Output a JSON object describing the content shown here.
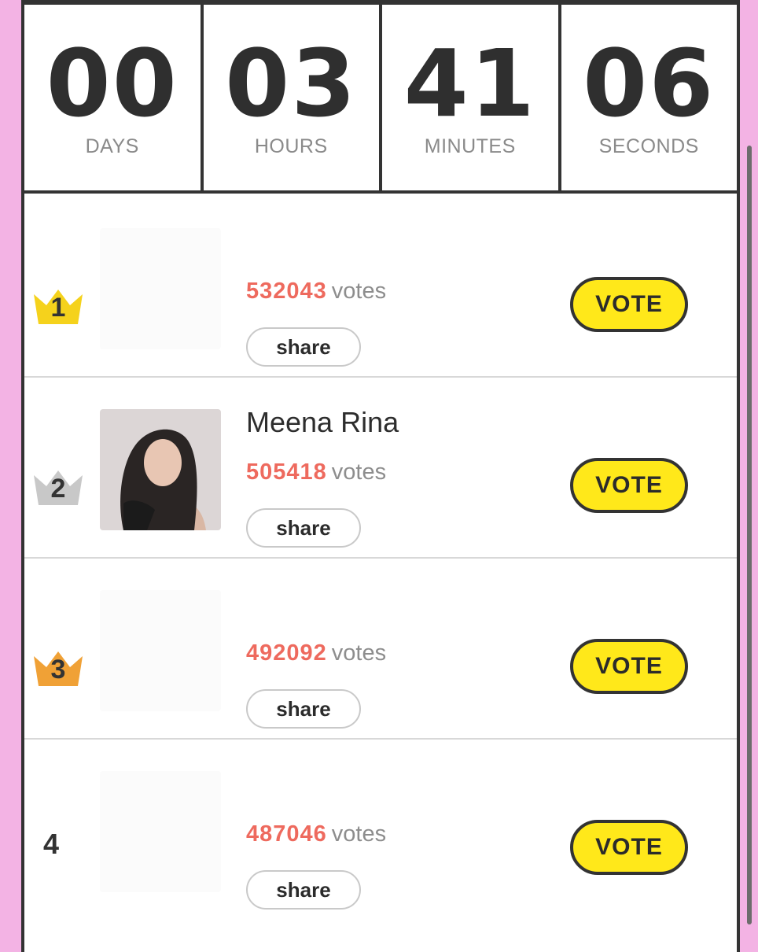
{
  "countdown": [
    {
      "value": "00",
      "unit": "DAYS"
    },
    {
      "value": "03",
      "unit": "HOURS"
    },
    {
      "value": "41",
      "unit": "MINUTES"
    },
    {
      "value": "06",
      "unit": "SECONDS"
    }
  ],
  "entries": [
    {
      "rank": "1",
      "name": "",
      "votes": "532043",
      "votes_label": "votes",
      "share_label": "share",
      "vote_label": "VOTE"
    },
    {
      "rank": "2",
      "name": "Meena Rina",
      "votes": "505418",
      "votes_label": "votes",
      "share_label": "share",
      "vote_label": "VOTE"
    },
    {
      "rank": "3",
      "name": "",
      "votes": "492092",
      "votes_label": "votes",
      "share_label": "share",
      "vote_label": "VOTE"
    },
    {
      "rank": "4",
      "name": "",
      "votes": "487046",
      "votes_label": "votes",
      "share_label": "share",
      "vote_label": "VOTE"
    }
  ],
  "colors": {
    "background": "#f3b3e4",
    "vote_button": "#ffe81a",
    "vote_count": "#ee6a5e",
    "crown_gold": "#f5d21c",
    "crown_silver": "#c8c8c8",
    "crown_bronze": "#f0a136"
  }
}
